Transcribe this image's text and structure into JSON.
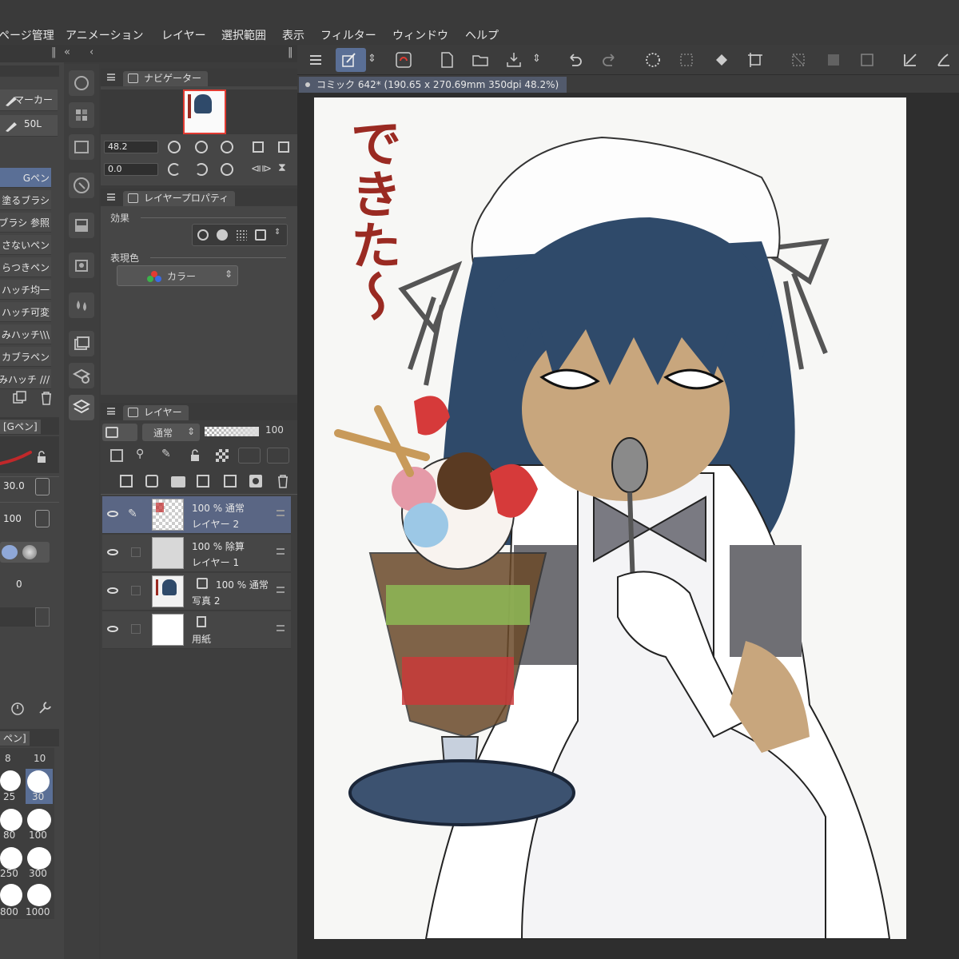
{
  "menu": [
    "ページ管理",
    "アニメーション",
    "レイヤー",
    "選択範囲",
    "表示",
    "フィルター",
    "ウィンドウ",
    "ヘルプ"
  ],
  "sub_tools": {
    "marker_label": "マーカー",
    "marker_sub": "50L",
    "items": [
      "Gペン",
      "塗るブラシ",
      "ブラシ 参照",
      "さないペン",
      "らつきペン",
      "ハッチ均一",
      "ハッチ可変",
      "みハッチ\\\\\\",
      "カブラペン",
      "みハッチ ///"
    ]
  },
  "tool_property": {
    "tab": "[Gペン]",
    "brush_size": "30.0",
    "opacity": "100",
    "stabilization": "0"
  },
  "brush_size_panel": {
    "tab": "ペン]",
    "sizes": [
      "8",
      "10",
      "25",
      "30",
      "80",
      "100",
      "250",
      "300",
      "800",
      "1000"
    ]
  },
  "navigator": {
    "tab": "ナビゲーター",
    "zoom": "48.2",
    "rotation": "0.0"
  },
  "layer_property": {
    "tab": "レイヤープロパティ",
    "effect_label": "効果",
    "expression_label": "表現色",
    "color_mode": "カラー"
  },
  "layers_panel": {
    "tab": "レイヤー",
    "blend_mode": "通常",
    "opacity": "100",
    "layers": [
      {
        "line1": "100 %  通常",
        "line2": "レイヤー 2"
      },
      {
        "line1": "100 %  除算",
        "line2": "レイヤー 1"
      },
      {
        "line1": "100 %  通常",
        "line2": "写真 2"
      },
      {
        "line1": "",
        "line2": "用紙"
      }
    ]
  },
  "document": {
    "tab": "コミック 642* (190.65 x 270.69mm 350dpi 48.2%)"
  },
  "artwork": {
    "handwritten_text": "できた〜"
  },
  "colors": {
    "accent": "#5a6f96",
    "panel": "#464646",
    "canvas_bg": "#2e2e2e",
    "hair": "#2f4a6a",
    "text_red": "#9a2a22"
  }
}
